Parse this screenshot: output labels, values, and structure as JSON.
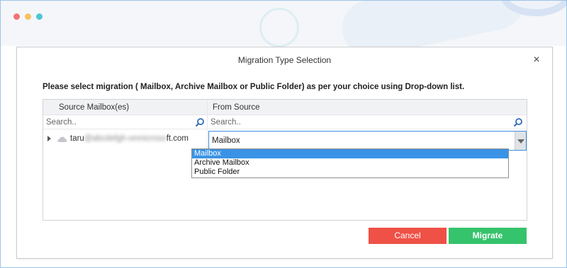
{
  "window": {
    "dots": [
      {
        "name": "close-dot",
        "color": "#f47174"
      },
      {
        "name": "minimize-dot",
        "color": "#f7c260"
      },
      {
        "name": "maximize-dot",
        "color": "#4fc5d6"
      }
    ]
  },
  "dialog": {
    "title": "Migration Type Selection",
    "close_label": "×",
    "instruction": "Please select migration ( Mailbox, Archive Mailbox or Public Folder) as per your choice using Drop-down list.",
    "columns": {
      "source": "Source Mailbox(es)",
      "from": "From Source"
    },
    "search": {
      "source_placeholder": "Search..",
      "from_placeholder": "Search.."
    },
    "row": {
      "email_prefix": "taru",
      "email_hidden": "@abcdefgh-onmicroso",
      "email_suffix": "ft.com",
      "selected_type": "Mailbox"
    },
    "dropdown_options": [
      "Mailbox",
      "Archive Mailbox",
      "Public Folder"
    ],
    "buttons": {
      "cancel": "Cancel",
      "migrate": "Migrate"
    },
    "colors": {
      "cancel": "#ef5146",
      "migrate": "#35c36c",
      "selected_option": "#3b93e6",
      "search_icon": "#2f6db3"
    }
  }
}
